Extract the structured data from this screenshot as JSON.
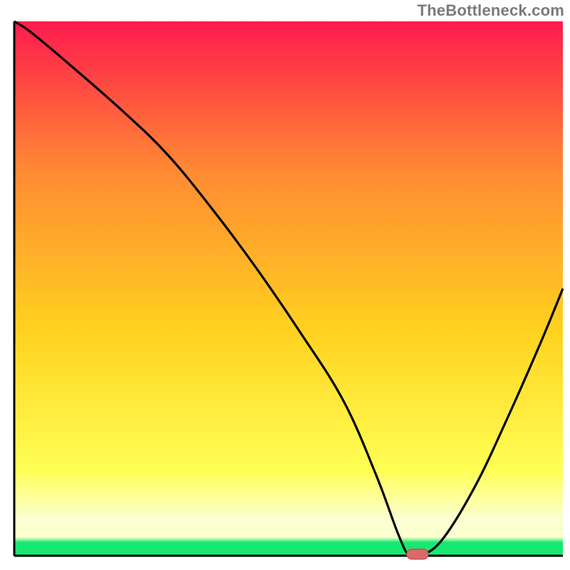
{
  "watermark": "TheBottleneck.com",
  "colors": {
    "axis": "#000000",
    "curve": "#000000",
    "marker_fill": "#d96a6a",
    "marker_stroke": "#c94f4f",
    "gradient_top": "#ff1a4d",
    "gradient_upper": "#ff8a33",
    "gradient_mid": "#ffd21f",
    "gradient_lower_yellow": "#ffff55",
    "gradient_pale": "#fcffcf",
    "gradient_green": "#17e86f"
  },
  "chart_data": {
    "type": "line",
    "title": "",
    "xlabel": "",
    "ylabel": "",
    "xlim": [
      0,
      100
    ],
    "ylim": [
      0,
      100
    ],
    "x": [
      0,
      3,
      10,
      20,
      28,
      36,
      44,
      52,
      60,
      66,
      70,
      72,
      74,
      78,
      84,
      90,
      96,
      100
    ],
    "values": [
      100,
      98,
      92,
      83,
      75,
      65,
      54,
      42,
      29,
      15,
      4,
      0,
      0,
      3,
      13,
      26,
      40,
      50
    ],
    "minimum_plateau": {
      "x_start": 70,
      "x_end": 75,
      "y": 0
    },
    "marker": {
      "x": 73.5,
      "y": 0.3
    }
  }
}
